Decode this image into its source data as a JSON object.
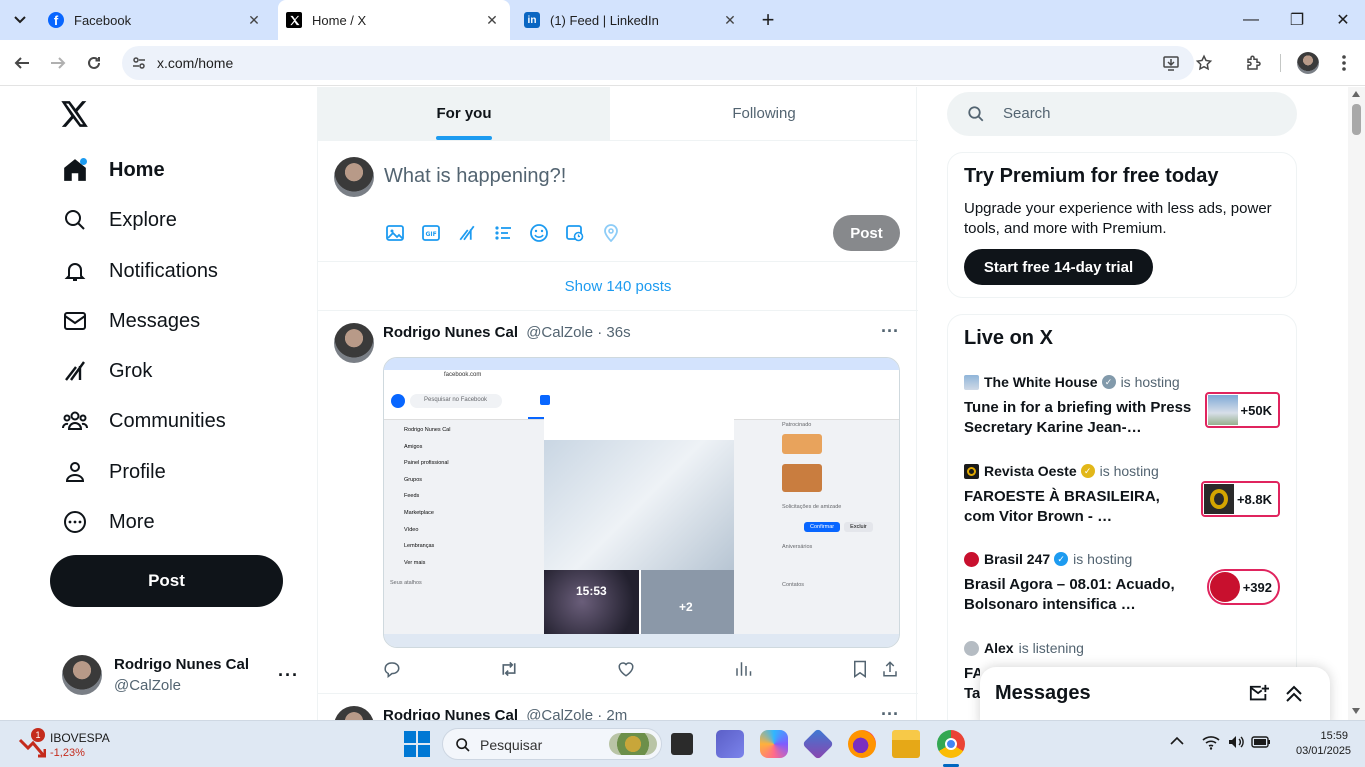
{
  "browser": {
    "tabs": [
      {
        "title": "Facebook",
        "active": false
      },
      {
        "title": "Home / X",
        "active": true
      },
      {
        "title": "(1) Feed | LinkedIn",
        "active": false
      }
    ],
    "url": "x.com/home"
  },
  "nav": {
    "items": [
      {
        "label": "Home",
        "icon": "home-icon"
      },
      {
        "label": "Explore",
        "icon": "search-icon"
      },
      {
        "label": "Notifications",
        "icon": "bell-icon"
      },
      {
        "label": "Messages",
        "icon": "envelope-icon"
      },
      {
        "label": "Grok",
        "icon": "grok-icon"
      },
      {
        "label": "Communities",
        "icon": "people-icon"
      },
      {
        "label": "Profile",
        "icon": "person-icon"
      },
      {
        "label": "More",
        "icon": "more-circle-icon"
      }
    ],
    "post_label": "Post"
  },
  "account": {
    "name": "Rodrigo Nunes Cal",
    "handle": "@CalZole"
  },
  "feed": {
    "tabs": [
      "For you",
      "Following"
    ],
    "composer_placeholder": "What is happening?!",
    "composer_post_label": "Post",
    "show_posts": "Show 140 posts",
    "posts": [
      {
        "author": "Rodrigo Nunes Cal",
        "meta": "@CalZole · 36s"
      },
      {
        "author": "Rodrigo Nunes Cal",
        "meta": "@CalZole · 2m"
      }
    ],
    "embedded": {
      "url": "facebook.com",
      "search": "Pesquisar no Facebook",
      "sidebar": [
        "Rodrigo Nunes Cal",
        "Amigos",
        "Painel profissional",
        "Grupos",
        "Feeds",
        "Marketplace",
        "Vídeo",
        "Lembranças",
        "Ver mais"
      ],
      "shortcuts_title": "Seus atalhos",
      "clock": "15:53",
      "plus": "+2",
      "sponsored": "Patrocinado",
      "friend_requests": "Solicitações de amizade",
      "confirm": "Confirmar",
      "delete": "Excluir",
      "birthdays": "Aniversários",
      "contacts": "Contatos"
    }
  },
  "right": {
    "search_placeholder": "Search",
    "premium": {
      "title": "Try Premium for free today",
      "body": "Upgrade your experience with less ads, power tools, and more with Premium.",
      "cta": "Start free 14-day trial"
    },
    "live": {
      "title": "Live on X",
      "items": [
        {
          "host": "The White House",
          "status": "is hosting",
          "title": "Tune in for a briefing with Press Secretary Karine Jean-…",
          "count": "+50K"
        },
        {
          "host": "Revista Oeste",
          "status": "is hosting",
          "title": "FAROESTE À BRASILEIRA, com Vitor Brown - …",
          "count": "+8.8K"
        },
        {
          "host": "Brasil 247",
          "status": "is hosting",
          "title": "Brasil Agora – 08.01: Acuado, Bolsonaro intensifica …",
          "count": "+392"
        },
        {
          "host": "Alex",
          "status": "is listening",
          "title": "FA… Ta…",
          "count": ""
        }
      ]
    },
    "messages_drawer": "Messages"
  },
  "taskbar": {
    "stock_name": "IBOVESPA",
    "stock_change": "-1,23%",
    "search_placeholder": "Pesquisar",
    "time": "15:59",
    "date": "03/01/2025",
    "notification_count": "1"
  }
}
